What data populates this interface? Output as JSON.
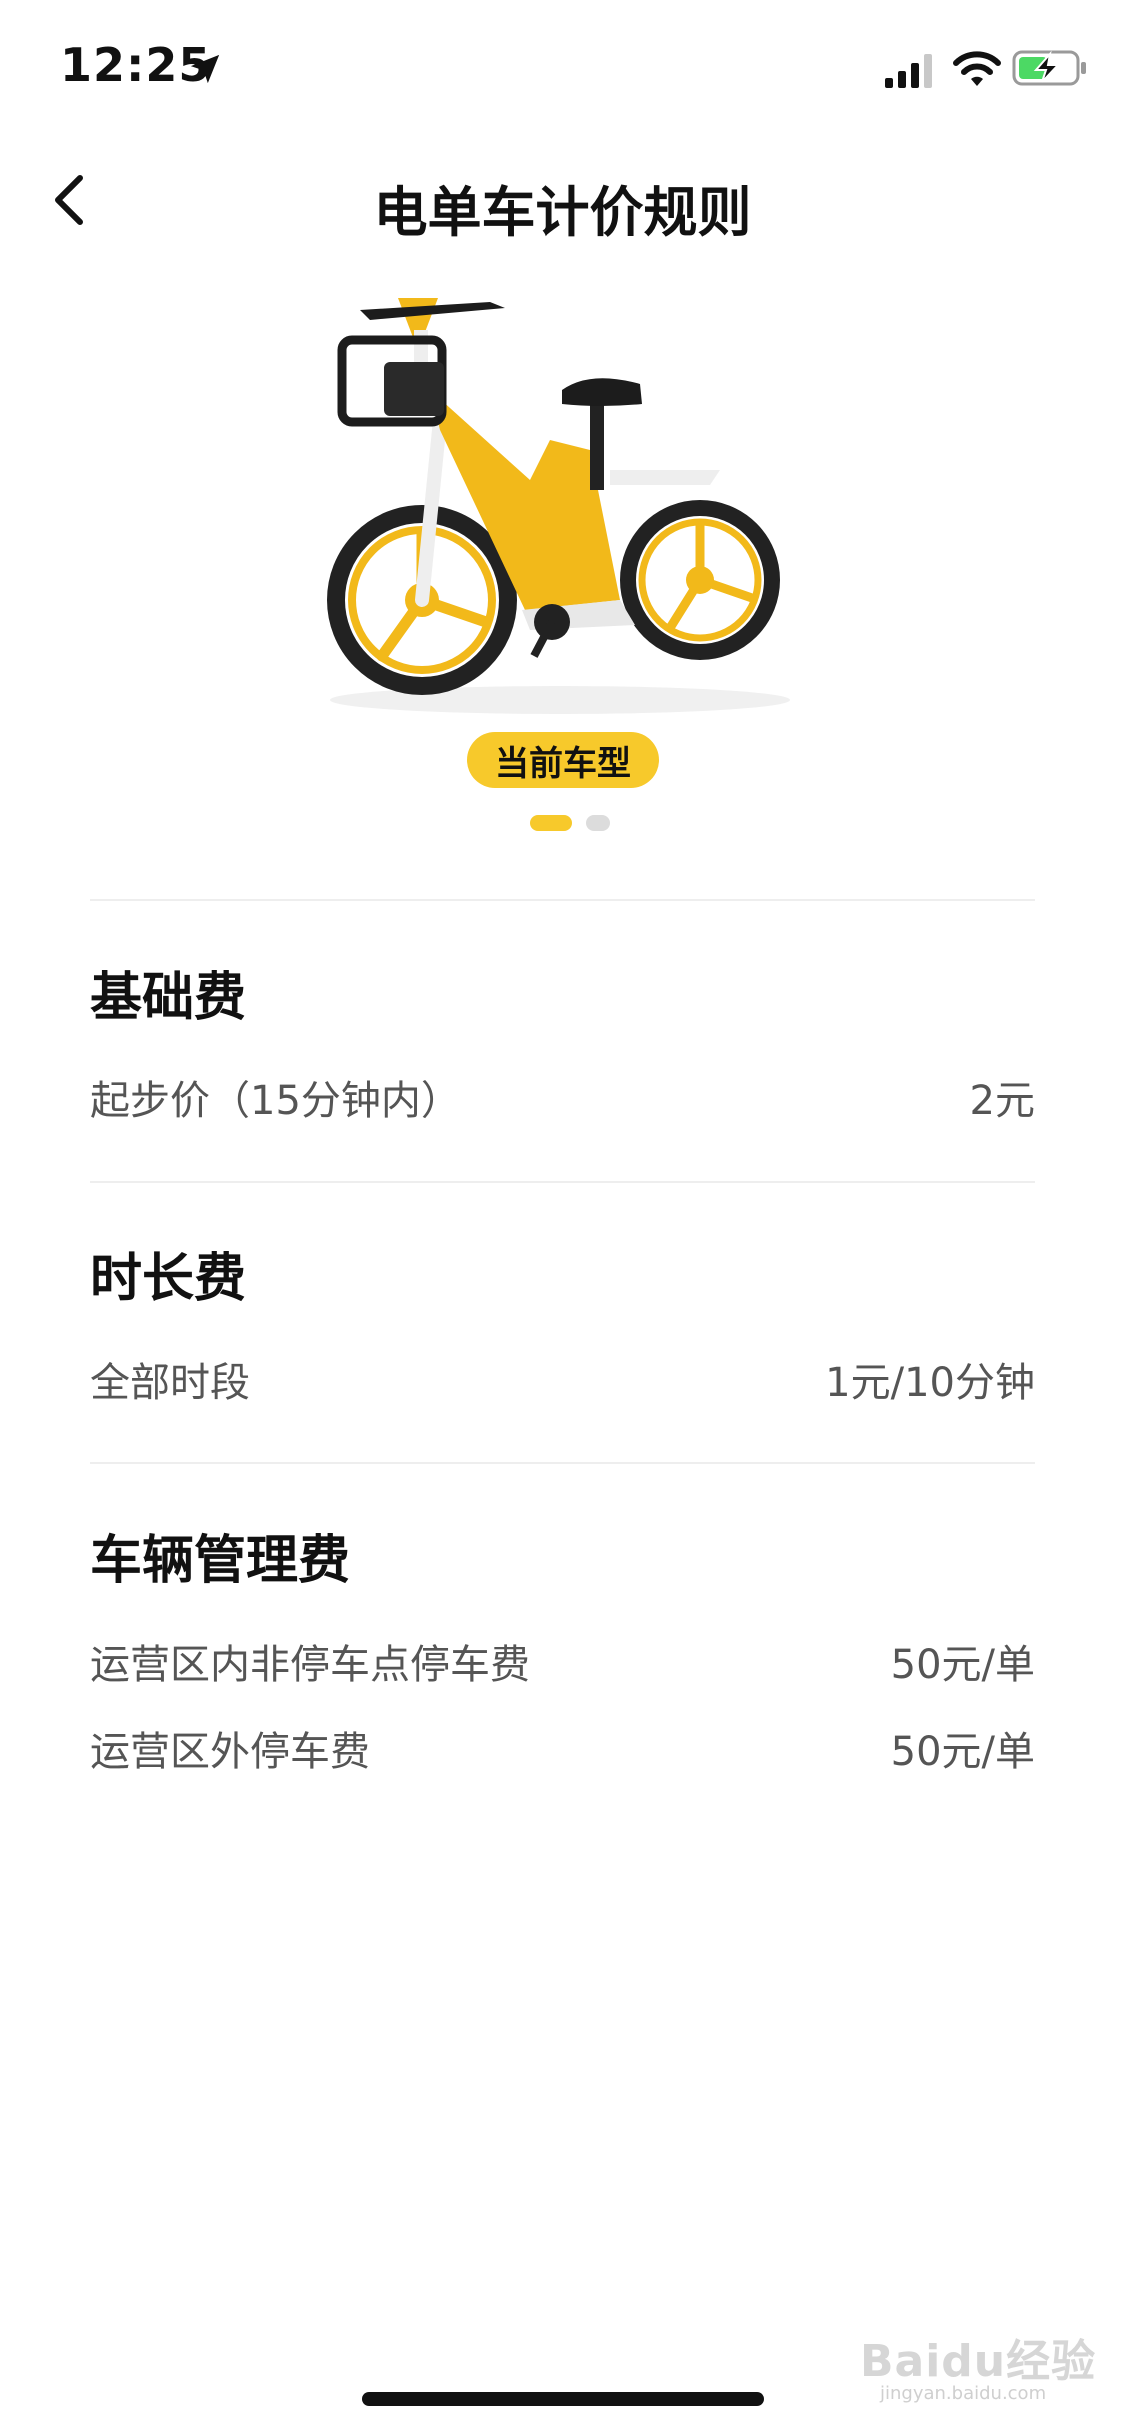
{
  "status_bar": {
    "time": "12:25",
    "icons": [
      "location-arrow-icon",
      "cellular-signal-icon",
      "wifi-icon",
      "battery-charging-icon"
    ]
  },
  "nav": {
    "title": "电单车计价规则",
    "back_icon": "chevron-left-icon"
  },
  "carousel": {
    "badge": "当前车型",
    "page_count": 2,
    "active_page": 1
  },
  "sections": {
    "base": {
      "title": "基础费",
      "rows": [
        {
          "label": "起步价（15分钟内）",
          "value": "2元"
        }
      ]
    },
    "duration": {
      "title": "时长费",
      "rows": [
        {
          "label": "全部时段",
          "value": "1元/10分钟"
        }
      ]
    },
    "management": {
      "title": "车辆管理费",
      "rows": [
        {
          "label": "运营区内非停车点停车费",
          "value": "50元/单"
        },
        {
          "label": "运营区外停车费",
          "value": "50元/单"
        }
      ]
    }
  },
  "watermark": {
    "brand": "Baidu经验",
    "url": "jingyan.baidu.com"
  },
  "colors": {
    "accent": "#f7c92b",
    "text_primary": "#111111",
    "text_secondary": "#555555",
    "divider": "#eeeeee"
  }
}
